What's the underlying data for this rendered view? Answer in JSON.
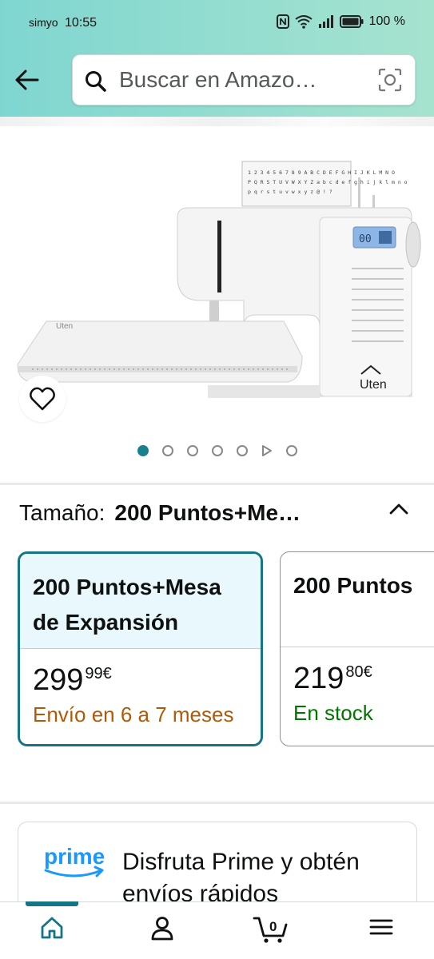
{
  "status_bar": {
    "carrier": "simyo",
    "time": "10:55",
    "battery": "100 %"
  },
  "search": {
    "placeholder": "Buscar en Amazo…"
  },
  "icons": [
    "back-arrow-icon",
    "search-icon",
    "camera-icon",
    "heart-icon",
    "chevron-up-icon",
    "prime-logo-icon",
    "home-icon",
    "account-icon",
    "cart-icon",
    "menu-icon"
  ],
  "product_image": {
    "brand": "Uten",
    "keyboard_strip": [
      "1 2 3 4 5 6 7 8 9 A B C D E F G H I J K L M N O",
      "P Q R S T U V W X Y Z a b c d e f g h i j k l m n o",
      "p q r s t u v w x y z @ ! ?"
    ],
    "lcd": "00",
    "carousel_dots": 7,
    "carousel_active": 1
  },
  "size_selector": {
    "label": "Tamaño:",
    "selected": "200 Puntos+Me…",
    "options": [
      {
        "title": "200 Puntos+Mesa de Expansión",
        "price_whole": "299",
        "price_fraction": "99",
        "currency": "€",
        "shipping": "Envío en 6 a 7 meses"
      },
      {
        "title": "200 Puntos",
        "price_whole": "219",
        "price_fraction": "80",
        "currency": "€",
        "shipping": "En stock"
      }
    ]
  },
  "prime": {
    "logo_text": "prime",
    "text": "Disfruta Prime y obtén envíos rápidos"
  },
  "bottom_nav": {
    "cart_count": "0"
  },
  "colors": {
    "header_gradient_start": "#7fd6d0",
    "header_gradient_end": "#a6e3cf",
    "accent": "#157586",
    "orange": "#b05a09",
    "green": "#007600",
    "prime_blue": "#1a98ff"
  }
}
